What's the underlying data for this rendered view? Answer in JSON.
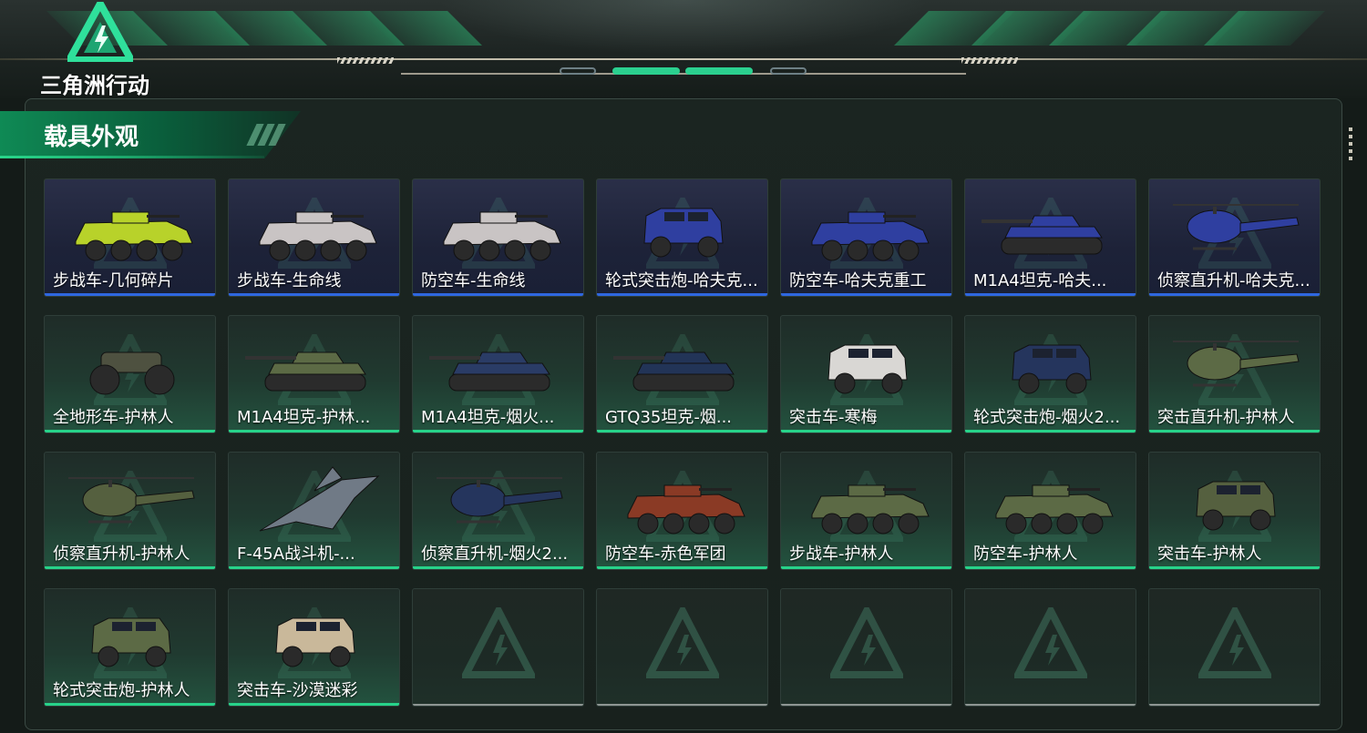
{
  "app": {
    "logo_text": "三角洲行动"
  },
  "panel": {
    "title": "载具外观"
  },
  "colors": {
    "accent_green": "#27d38a",
    "accent_blue": "#2e67e0",
    "title_green": "#0f8a55",
    "empty_bar": "#8e9693"
  },
  "cards": [
    {
      "name": "步战车-几何碎片",
      "style": "blue",
      "icon": "ifv-vehicle-icon",
      "color": "#b8d22a"
    },
    {
      "name": "步战车-生命线",
      "style": "blue",
      "icon": "ifv-vehicle-icon",
      "color": "#c9c4c4"
    },
    {
      "name": "防空车-生命线",
      "style": "blue",
      "icon": "ifv-vehicle-icon",
      "color": "#c9c4c4"
    },
    {
      "name": "轮式突击炮-哈夫克...",
      "style": "blue",
      "icon": "armored-car-icon",
      "color": "#2f3fa0"
    },
    {
      "name": "防空车-哈夫克重工",
      "style": "blue",
      "icon": "ifv-vehicle-icon",
      "color": "#2f3fa0"
    },
    {
      "name": "M1A4坦克-哈夫...",
      "style": "blue",
      "icon": "tank-icon",
      "color": "#2f3fa0"
    },
    {
      "name": "侦察直升机-哈夫克...",
      "style": "blue",
      "icon": "helicopter-icon",
      "color": "#2f3fa0"
    },
    {
      "name": "全地形车-护林人",
      "style": "green",
      "icon": "atv-icon",
      "color": "#4e5140"
    },
    {
      "name": "M1A4坦克-护林...",
      "style": "green",
      "icon": "tank-icon",
      "color": "#5c6a45"
    },
    {
      "name": "M1A4坦克-烟火...",
      "style": "green",
      "icon": "tank-icon",
      "color": "#2a3c66"
    },
    {
      "name": "GTQ35坦克-烟...",
      "style": "green",
      "icon": "tank-icon",
      "color": "#223457"
    },
    {
      "name": "突击车-寒梅",
      "style": "green",
      "icon": "armored-car-icon",
      "color": "#d9d7d4"
    },
    {
      "name": "轮式突击炮-烟火2...",
      "style": "green",
      "icon": "armored-car-icon",
      "color": "#25355d"
    },
    {
      "name": "突击直升机-护林人",
      "style": "green",
      "icon": "helicopter-icon",
      "color": "#5c6a45"
    },
    {
      "name": "侦察直升机-护林人",
      "style": "green",
      "icon": "helicopter-icon",
      "color": "#55603f"
    },
    {
      "name": "F-45A战斗机-...",
      "style": "green",
      "icon": "jet-icon",
      "color": "#707a86"
    },
    {
      "name": "侦察直升机-烟火2...",
      "style": "green",
      "icon": "helicopter-icon",
      "color": "#25355d"
    },
    {
      "name": "防空车-赤色军团",
      "style": "green",
      "icon": "ifv-vehicle-icon",
      "color": "#8a3a25"
    },
    {
      "name": "步战车-护林人",
      "style": "green",
      "icon": "ifv-vehicle-icon",
      "color": "#5c6a45"
    },
    {
      "name": "防空车-护林人",
      "style": "green",
      "icon": "ifv-vehicle-icon",
      "color": "#5c6a45"
    },
    {
      "name": "突击车-护林人",
      "style": "green",
      "icon": "armored-car-icon",
      "color": "#55603f"
    },
    {
      "name": "轮式突击炮-护林人",
      "style": "green",
      "icon": "armored-car-icon",
      "color": "#5c6a45"
    },
    {
      "name": "突击车-沙漠迷彩",
      "style": "green",
      "icon": "armored-car-icon",
      "color": "#c9b89a"
    },
    {
      "name": "",
      "style": "empty",
      "icon": "empty-slot-icon",
      "color": ""
    },
    {
      "name": "",
      "style": "empty",
      "icon": "empty-slot-icon",
      "color": ""
    },
    {
      "name": "",
      "style": "empty",
      "icon": "empty-slot-icon",
      "color": ""
    },
    {
      "name": "",
      "style": "empty",
      "icon": "empty-slot-icon",
      "color": ""
    },
    {
      "name": "",
      "style": "empty",
      "icon": "empty-slot-icon",
      "color": ""
    }
  ]
}
